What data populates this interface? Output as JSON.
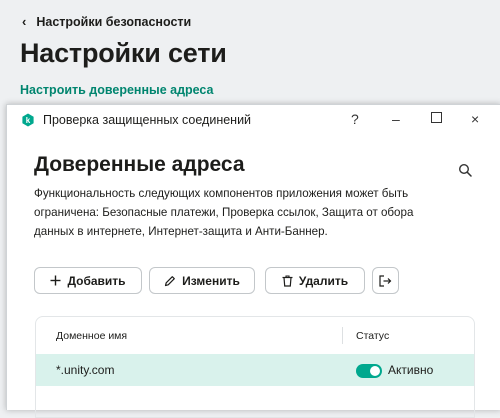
{
  "background": {
    "back_label": "Настройки безопасности",
    "title": "Настройки сети",
    "link": "Настроить доверенные адреса"
  },
  "window": {
    "title": "Проверка защищенных соединений",
    "controls": {
      "help": "?",
      "minimize": "–",
      "close": "×"
    }
  },
  "content": {
    "heading": "Доверенные адреса",
    "description": "Функциональность следующих компонентов приложения может быть ограничена: Безопасные платежи, Проверка ссылок, Защита от обора данных в интернете, Интернет-защита и Анти-Баннер."
  },
  "toolbar": {
    "add_label": "Добавить",
    "edit_label": "Изменить",
    "delete_label": "Удалить"
  },
  "table": {
    "columns": [
      "Доменное имя",
      "Статус"
    ],
    "rows": [
      {
        "domain": "*.unity.com",
        "status": "Активно",
        "enabled": true
      }
    ]
  },
  "colors": {
    "accent": "#00856f",
    "toggle": "#00a88e",
    "row_selected": "#d9f2ec"
  },
  "icons": [
    "chevron-left-icon",
    "kaspersky-logo-icon",
    "search-icon",
    "plus-icon",
    "pencil-icon",
    "trash-icon",
    "export-icon"
  ]
}
